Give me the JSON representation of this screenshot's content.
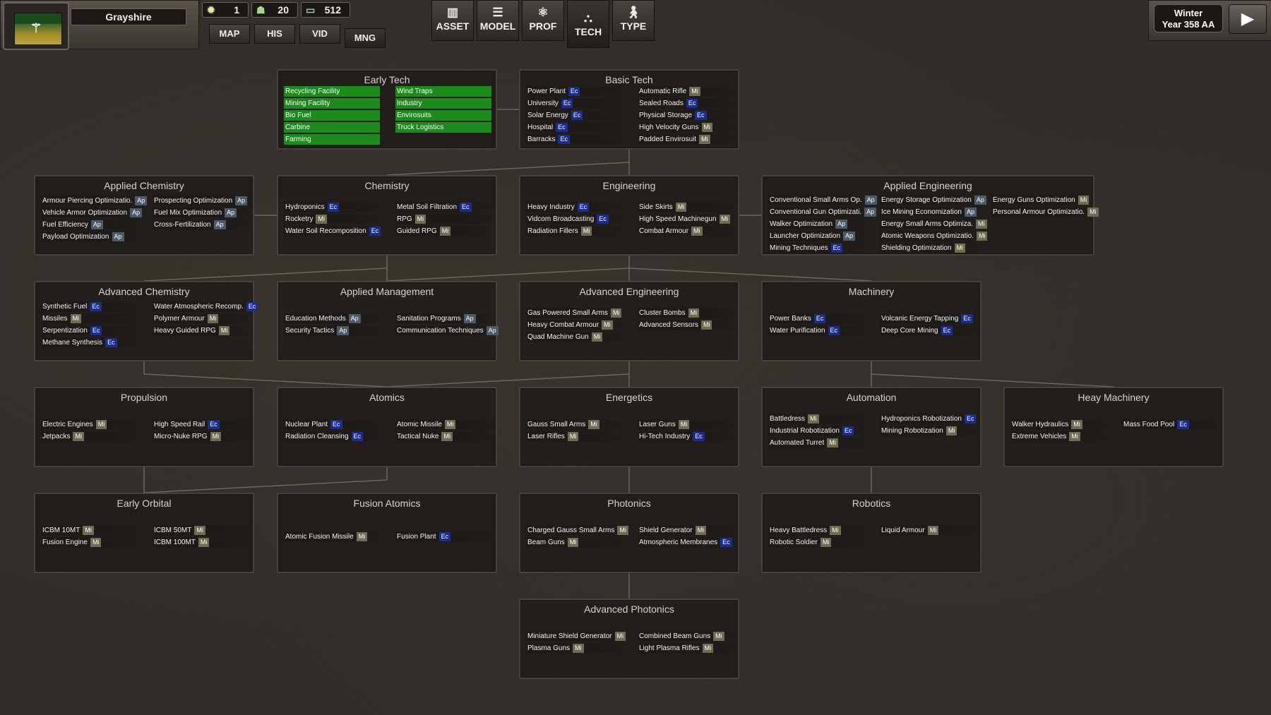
{
  "topbar": {
    "city_name": "Grayshire",
    "stats": [
      {
        "icon": "sun-icon",
        "value": "1"
      },
      {
        "icon": "population-icon",
        "value": "20"
      },
      {
        "icon": "money-icon",
        "value": "512"
      }
    ],
    "nav": [
      {
        "label": "MAP"
      },
      {
        "label": "HIS"
      },
      {
        "label": "VID"
      },
      {
        "label": "MNG"
      }
    ],
    "modes": [
      {
        "label": "ASSET",
        "icon": "asset-icon"
      },
      {
        "label": "MODEL",
        "icon": "model-icon"
      },
      {
        "label": "PROF",
        "icon": "prof-icon"
      },
      {
        "label": "TECH",
        "icon": "tech-icon"
      },
      {
        "label": "TYPE",
        "icon": "type-icon"
      }
    ],
    "season": "Winter",
    "year": "Year 358 AA"
  },
  "tech_tree": {
    "early_tech": {
      "title": "Early Tech",
      "left": [
        [
          "Recycling Facility",
          ""
        ],
        [
          "Mining Facility",
          ""
        ],
        [
          "Bio Fuel",
          ""
        ],
        [
          "Carbine",
          ""
        ],
        [
          "Farming",
          ""
        ]
      ],
      "right": [
        [
          "Wind Traps",
          ""
        ],
        [
          "Industry",
          ""
        ],
        [
          "Envirosuits",
          ""
        ],
        [
          "Truck Logistics",
          ""
        ]
      ]
    },
    "basic_tech": {
      "title": "Basic Tech",
      "left": [
        [
          "Power Plant",
          "Ec"
        ],
        [
          "University",
          "Ec"
        ],
        [
          "Solar Energy",
          "Ec"
        ],
        [
          "Hospital",
          "Ec"
        ],
        [
          "Barracks",
          "Ec"
        ]
      ],
      "right": [
        [
          "Automatic Rifle",
          "Mi"
        ],
        [
          "Sealed Roads",
          "Ec"
        ],
        [
          "Physical Storage",
          "Ec"
        ],
        [
          "High Velocity Guns",
          "Mi"
        ],
        [
          "Padded Envirosuit",
          "Mi"
        ]
      ]
    },
    "applied_chemistry": {
      "title": "Applied Chemistry",
      "left": [
        [
          "Armour Piercing Optimizatio.",
          "Ap"
        ],
        [
          "Vehicle Armor Optimization",
          "Ap"
        ],
        [
          "Fuel Efficiency",
          "Ap"
        ],
        [
          "Payload Optimization",
          "Ap"
        ]
      ],
      "right": [
        [
          "Prospecting Optimization",
          "Ap"
        ],
        [
          "Fuel Mix Optimization",
          "Ap"
        ],
        [
          "Cross-Fertilization",
          "Ap"
        ]
      ]
    },
    "chemistry": {
      "title": "Chemistry",
      "left": [
        [
          "Hydroponics",
          "Ec"
        ],
        [
          "Rocketry",
          "Mi"
        ],
        [
          "Water Soil Recomposition",
          "Ec"
        ]
      ],
      "right": [
        [
          "Metal Soil Filtration",
          "Ec"
        ],
        [
          "RPG",
          "Mi"
        ],
        [
          "Guided RPG",
          "Mi"
        ]
      ]
    },
    "engineering": {
      "title": "Engineering",
      "left": [
        [
          "Heavy Industry",
          "Ec"
        ],
        [
          "Vidcom Broadcasting",
          "Ec"
        ],
        [
          "Radiation Fillers",
          "Mi"
        ]
      ],
      "right": [
        [
          "Side Skirts",
          "Mi"
        ],
        [
          "High Speed Machinegun",
          "Mi"
        ],
        [
          "Combat Armour",
          "Mi"
        ]
      ]
    },
    "applied_engineering": {
      "title": "Applied Engineering",
      "c1": [
        [
          "Conventional Small Arms Op.",
          "Ap"
        ],
        [
          "Conventional Gun Optimizati.",
          "Ap"
        ],
        [
          "Walker Optimization",
          "Ap"
        ],
        [
          "Launcher Optimization",
          "Ap"
        ],
        [
          "Mining Techniques",
          "Ec"
        ]
      ],
      "c2": [
        [
          "Energy Storage Optimization",
          "Ap"
        ],
        [
          "Ice Mining Economization",
          "Ap"
        ],
        [
          "Energy Small Arms Optimiza.",
          "Mi"
        ],
        [
          "Atomic Weapons Optimizatio.",
          "Mi"
        ],
        [
          "Shielding Optimization",
          "Mi"
        ]
      ],
      "c3": [
        [
          "Energy Guns Optimization",
          "Mi"
        ],
        [
          "Personal Armour Optimizatio.",
          "Mi"
        ]
      ]
    },
    "advanced_chemistry": {
      "title": "Advanced Chemistry",
      "left": [
        [
          "Synthetic Fuel",
          "Ec"
        ],
        [
          "Missiles",
          "Mi"
        ],
        [
          "Serpentization",
          "Ec"
        ],
        [
          "Methane Synthesis",
          "Ec"
        ]
      ],
      "right": [
        [
          "Water Atmospheric Recomp.",
          "Ec"
        ],
        [
          "Polymer Armour",
          "Mi"
        ],
        [
          "Heavy Guided RPG",
          "Mi"
        ]
      ]
    },
    "applied_management": {
      "title": "Applied Management",
      "left": [
        [
          "Education Methods",
          "Ap"
        ],
        [
          "Security Tactics",
          "Ap"
        ]
      ],
      "right": [
        [
          "Sanitation Programs",
          "Ap"
        ],
        [
          "Communication Techniques",
          "Ap"
        ]
      ]
    },
    "advanced_engineering": {
      "title": "Advanced Engineering",
      "left": [
        [
          "Gas Powered Small Arms",
          "Mi"
        ],
        [
          "Heavy Combat Armour",
          "Mi"
        ],
        [
          "Quad Machine Gun",
          "Mi"
        ]
      ],
      "right": [
        [
          "Cluster Bombs",
          "Mi"
        ],
        [
          "Advanced Sensors",
          "Mi"
        ]
      ]
    },
    "machinery": {
      "title": "Machinery",
      "left": [
        [
          "Power Banks",
          "Ec"
        ],
        [
          "Water Purification",
          "Ec"
        ]
      ],
      "right": [
        [
          "Volcanic Energy Tapping",
          "Ec"
        ],
        [
          "Deep Core Mining",
          "Ec"
        ]
      ]
    },
    "propulsion": {
      "title": "Propulsion",
      "left": [
        [
          "Electric Engines",
          "Mi"
        ],
        [
          "Jetpacks",
          "Mi"
        ]
      ],
      "right": [
        [
          "High Speed Rail",
          "Ec"
        ],
        [
          "Micro-Nuke RPG",
          "Mi"
        ]
      ]
    },
    "atomics": {
      "title": "Atomics",
      "left": [
        [
          "Nuclear Plant",
          "Ec"
        ],
        [
          "Radiation Cleansing",
          "Ec"
        ]
      ],
      "right": [
        [
          "Atomic Missile",
          "Mi"
        ],
        [
          "Tactical Nuke",
          "Mi"
        ]
      ]
    },
    "energetics": {
      "title": "Energetics",
      "left": [
        [
          "Gauss Small Arms",
          "Mi"
        ],
        [
          "Laser Rifles",
          "Mi"
        ]
      ],
      "right": [
        [
          "Laser Guns",
          "Mi"
        ],
        [
          "Hi-Tech Industry",
          "Ec"
        ]
      ]
    },
    "automation": {
      "title": "Automation",
      "left": [
        [
          "Battledress",
          "Mi"
        ],
        [
          "Industrial Robotization",
          "Ec"
        ],
        [
          "Automated Turret",
          "Mi"
        ]
      ],
      "right": [
        [
          "Hydroponics Robotization",
          "Ec"
        ],
        [
          "Mining Robotization",
          "Mi"
        ]
      ]
    },
    "heavy_machinery": {
      "title": "Heay Machinery",
      "left": [
        [
          "Walker Hydraulics",
          "Mi"
        ],
        [
          "Extreme Vehicles",
          "Mi"
        ]
      ],
      "right": [
        [
          "Mass Food Pool",
          "Ec"
        ]
      ]
    },
    "early_orbital": {
      "title": "Early Orbital",
      "left": [
        [
          "ICBM 10MT",
          "Mi"
        ],
        [
          "Fusion Engine",
          "Mi"
        ]
      ],
      "right": [
        [
          "ICBM 50MT",
          "Mi"
        ],
        [
          "ICBM 100MT",
          "Mi"
        ]
      ]
    },
    "fusion_atomics": {
      "title": "Fusion Atomics",
      "left": [
        [
          "Atomic Fusion Missile",
          "Mi"
        ]
      ],
      "right": [
        [
          "Fusion Plant",
          "Ec"
        ]
      ]
    },
    "photonics": {
      "title": "Photonics",
      "left": [
        [
          "Charged Gauss Small Arms",
          "Mi"
        ],
        [
          "Beam Guns",
          "Mi"
        ]
      ],
      "right": [
        [
          "Shield Generator",
          "Mi"
        ],
        [
          "Atmospheric Membranes",
          "Ec"
        ]
      ]
    },
    "robotics": {
      "title": "Robotics",
      "left": [
        [
          "Heavy Battledress",
          "Mi"
        ],
        [
          "Robotic Soldier",
          "Mi"
        ]
      ],
      "right": [
        [
          "Liquid Armour",
          "Mi"
        ]
      ]
    },
    "advanced_photonics": {
      "title": "Advanced Photonics",
      "left": [
        [
          "Miniature Shield Generator",
          "Mi"
        ],
        [
          "Plasma Guns",
          "Mi"
        ]
      ],
      "right": [
        [
          "Combined Beam Guns",
          "Mi"
        ],
        [
          "Light Plasma Rifles",
          "Mi"
        ]
      ]
    }
  }
}
